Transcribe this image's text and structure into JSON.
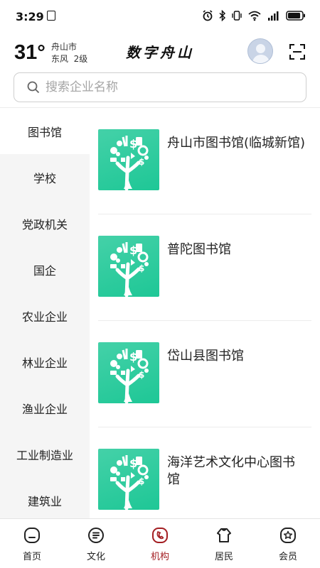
{
  "status_bar": {
    "time": "3:29",
    "battery_level": 0.9
  },
  "header": {
    "temperature": "31°",
    "city": "舟山市",
    "wind": "东风  2级",
    "title": "数字舟山"
  },
  "search": {
    "placeholder": "搜索企业名称"
  },
  "sidebar": {
    "items": [
      {
        "label": "图书馆",
        "active": true
      },
      {
        "label": "学校"
      },
      {
        "label": "党政机关"
      },
      {
        "label": "国企"
      },
      {
        "label": "农业企业"
      },
      {
        "label": "林业企业"
      },
      {
        "label": "渔业企业"
      },
      {
        "label": "工业制造业"
      },
      {
        "label": "建筑业"
      }
    ]
  },
  "list": {
    "items": [
      {
        "name": "舟山市图书馆(临城新馆)"
      },
      {
        "name": "普陀图书馆"
      },
      {
        "name": "岱山县图书馆"
      },
      {
        "name": "海洋艺术文化中心图书馆"
      }
    ]
  },
  "bottom_nav": {
    "tabs": [
      {
        "label": "首页",
        "icon": "home-icon"
      },
      {
        "label": "文化",
        "icon": "culture-icon"
      },
      {
        "label": "机构",
        "icon": "institution-icon",
        "active": true
      },
      {
        "label": "居民",
        "icon": "resident-icon"
      },
      {
        "label": "会员",
        "icon": "member-icon"
      }
    ]
  },
  "colors": {
    "accent": "#a31e22",
    "thumb_green": "#2fcf9d",
    "sidebar_bg": "#f5f5f5"
  }
}
